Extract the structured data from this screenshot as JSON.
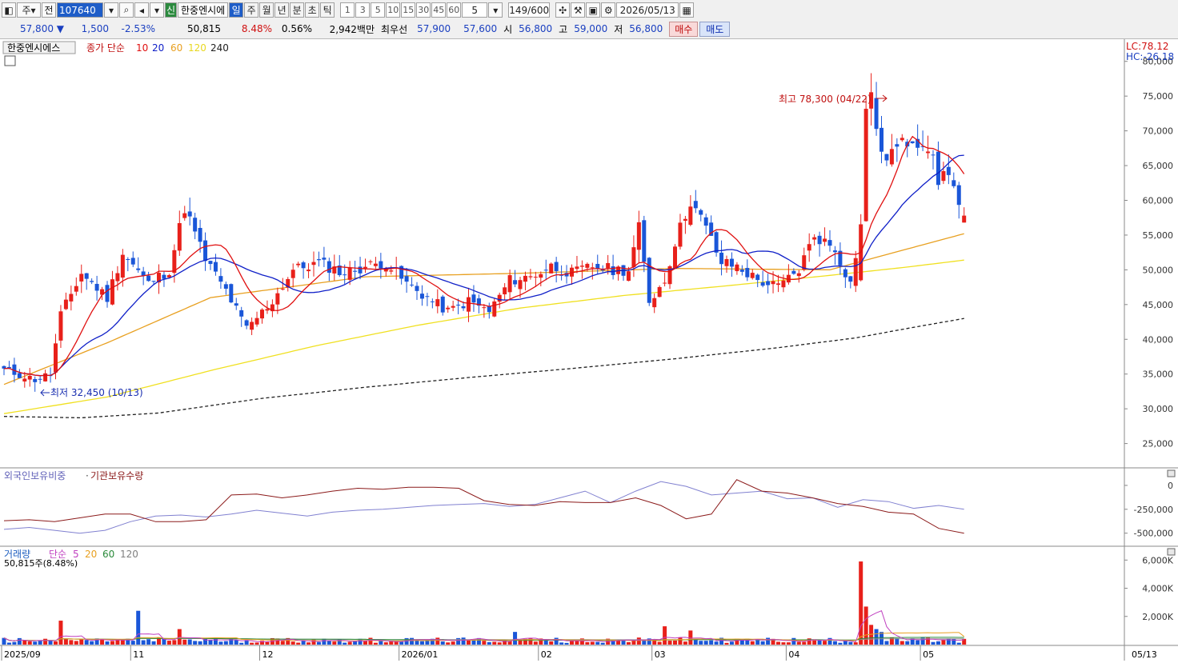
{
  "toolbar": {
    "mode_label": "주",
    "type_label": "전",
    "code": "107640",
    "name": "한중엔시에",
    "badge_new": "신",
    "periods": [
      "일",
      "주",
      "월",
      "년",
      "분",
      "초",
      "틱"
    ],
    "active_period": "일",
    "intervals": [
      "1",
      "3",
      "5",
      "10",
      "15",
      "30",
      "45",
      "60"
    ],
    "unit_value": "5",
    "count": "149/600",
    "date": "2026/05/13"
  },
  "quote": {
    "price": "57,800 ▼",
    "change": "1,500",
    "change_pct": "-2.53%",
    "volume": "50,815",
    "turnover_pct": "8.48%",
    "ratio": "0.56%",
    "amount": "2,942백만",
    "best_label": "최우선",
    "best_ask": "57,900",
    "best_bid": "57,600",
    "open_label": "시",
    "open": "56,800",
    "high_label": "고",
    "high": "59,000",
    "low_label": "저",
    "low": "56,800",
    "buy_label": "매수",
    "sell_label": "매도"
  },
  "colors": {
    "up": "#e8201a",
    "down": "#1a56d8",
    "ma10": "#e01010",
    "ma20": "#1020c8",
    "ma60": "#e8a020",
    "ma120": "#f0e020",
    "ma240": "#202020",
    "foreign": "#8080d0",
    "inst": "#8b1a1a"
  },
  "chart_data": [
    {
      "type": "candlestick",
      "legend": {
        "name": "한중엔시에스",
        "price_label": "종가 단순",
        "ma": [
          "10",
          "20",
          "60",
          "120",
          "240"
        ]
      },
      "corner_labels": [
        "LC:78.12",
        "HC:-26.18"
      ],
      "y_ticks": [
        "80,000",
        "75,000",
        "70,000",
        "65,000",
        "60,000",
        "55,000",
        "50,000",
        "45,000",
        "40,000",
        "35,000",
        "30,000",
        "25,000"
      ],
      "ylim": [
        21500,
        82500
      ],
      "annotations": {
        "high": "최고 78,300 (04/22)",
        "low": "최저 32,450 (10/13)"
      },
      "x_ticks": [
        "2025/09",
        "11",
        "12",
        "2026/01",
        "02",
        "03",
        "04",
        "05"
      ],
      "last_date_label": "05/13",
      "anchors": [
        {
          "i": 0,
          "c": 35600
        },
        {
          "i": 6,
          "c": 34200
        },
        {
          "i": 9,
          "c": 35000
        },
        {
          "i": 11,
          "c": 43500
        },
        {
          "i": 15,
          "c": 49500
        },
        {
          "i": 20,
          "c": 46000
        },
        {
          "i": 23,
          "c": 52500
        },
        {
          "i": 28,
          "c": 48000
        },
        {
          "i": 32,
          "c": 50000
        },
        {
          "i": 35,
          "c": 59000
        },
        {
          "i": 39,
          "c": 51500
        },
        {
          "i": 43,
          "c": 47000
        },
        {
          "i": 47,
          "c": 41500
        },
        {
          "i": 52,
          "c": 45500
        },
        {
          "i": 56,
          "c": 50000
        },
        {
          "i": 61,
          "c": 51000
        },
        {
          "i": 66,
          "c": 49500
        },
        {
          "i": 70,
          "c": 50500
        },
        {
          "i": 74,
          "c": 51000
        },
        {
          "i": 78,
          "c": 48000
        },
        {
          "i": 82,
          "c": 46000
        },
        {
          "i": 86,
          "c": 44000
        },
        {
          "i": 90,
          "c": 45500
        },
        {
          "i": 94,
          "c": 44000
        },
        {
          "i": 98,
          "c": 48500
        },
        {
          "i": 102,
          "c": 49000
        },
        {
          "i": 106,
          "c": 50500
        },
        {
          "i": 110,
          "c": 49500
        },
        {
          "i": 114,
          "c": 50500
        },
        {
          "i": 118,
          "c": 50000
        },
        {
          "i": 121,
          "c": 50000
        },
        {
          "i": 123,
          "c": 56000
        },
        {
          "i": 125,
          "c": 45500
        },
        {
          "i": 128,
          "c": 48500
        },
        {
          "i": 130,
          "c": 54000
        },
        {
          "i": 133,
          "c": 60000
        },
        {
          "i": 136,
          "c": 56000
        },
        {
          "i": 139,
          "c": 51000
        },
        {
          "i": 142,
          "c": 50500
        },
        {
          "i": 146,
          "c": 48500
        },
        {
          "i": 150,
          "c": 47500
        },
        {
          "i": 154,
          "c": 50000
        },
        {
          "i": 157,
          "c": 55000
        },
        {
          "i": 161,
          "c": 53000
        },
        {
          "i": 164,
          "c": 48000
        },
        {
          "i": 166,
          "c": 56500
        },
        {
          "i": 167,
          "c": 72500
        },
        {
          "i": 168,
          "c": 75800
        },
        {
          "i": 170,
          "c": 66000
        },
        {
          "i": 173,
          "c": 67500
        },
        {
          "i": 176,
          "c": 69000
        },
        {
          "i": 179,
          "c": 68000
        },
        {
          "i": 181,
          "c": 62800
        },
        {
          "i": 183,
          "c": 64500
        },
        {
          "i": 185,
          "c": 59200
        },
        {
          "i": 186,
          "c": 57800
        }
      ],
      "ma_anchors": {
        "ma60": [
          [
            0,
            33500
          ],
          [
            20,
            39500
          ],
          [
            40,
            46000
          ],
          [
            70,
            49000
          ],
          [
            100,
            49500
          ],
          [
            130,
            50200
          ],
          [
            160,
            50000
          ],
          [
            175,
            53000
          ],
          [
            186,
            55200
          ]
        ],
        "ma120": [
          [
            0,
            29300
          ],
          [
            20,
            31700
          ],
          [
            40,
            35500
          ],
          [
            60,
            39000
          ],
          [
            80,
            42000
          ],
          [
            100,
            44500
          ],
          [
            120,
            46300
          ],
          [
            140,
            47700
          ],
          [
            160,
            49200
          ],
          [
            175,
            50400
          ],
          [
            186,
            51400
          ]
        ],
        "ma240": [
          [
            0,
            28900
          ],
          [
            15,
            28700
          ],
          [
            30,
            29400
          ],
          [
            50,
            31500
          ],
          [
            70,
            33100
          ],
          [
            90,
            34500
          ],
          [
            110,
            35800
          ],
          [
            130,
            37200
          ],
          [
            150,
            38800
          ],
          [
            165,
            40200
          ],
          [
            176,
            41700
          ],
          [
            186,
            43000
          ]
        ]
      }
    },
    {
      "type": "line",
      "title_a": "외국인보유비중",
      "title_b": "기관보유수량",
      "y_ticks": [
        "0",
        "-250,000",
        "-500,000"
      ],
      "ylim": [
        -620000,
        150000
      ],
      "series": [
        {
          "name": "외국인보유비중",
          "values": [
            -460000,
            -440000,
            -470000,
            -500000,
            -470000,
            -380000,
            -320000,
            -310000,
            -330000,
            -300000,
            -260000,
            -290000,
            -320000,
            -280000,
            -260000,
            -250000,
            -230000,
            -210000,
            -200000,
            -190000,
            -220000,
            -200000,
            -130000,
            -60000,
            -180000,
            -60000,
            40000,
            -10000,
            -100000,
            -80000,
            -60000,
            -140000,
            -130000,
            -230000,
            -150000,
            -170000,
            -240000,
            -210000,
            -250000
          ]
        },
        {
          "name": "기관보유수량",
          "values": [
            -370000,
            -360000,
            -380000,
            -340000,
            -300000,
            -300000,
            -380000,
            -380000,
            -360000,
            -100000,
            -90000,
            -130000,
            -100000,
            -60000,
            -30000,
            -40000,
            -20000,
            -20000,
            -30000,
            -160000,
            -200000,
            -210000,
            -170000,
            -180000,
            -180000,
            -130000,
            -210000,
            -350000,
            -300000,
            60000,
            -60000,
            -80000,
            -130000,
            -190000,
            -220000,
            -280000,
            -300000,
            -450000,
            -500000
          ]
        }
      ]
    },
    {
      "type": "bar",
      "title": "거래량",
      "ma_label": "단순",
      "ma": [
        "5",
        "20",
        "60",
        "120"
      ],
      "sub_label": "50,815주(8.48%)",
      "y_ticks": [
        "6,000K",
        "4,000K",
        "2,000K"
      ],
      "ylim": [
        0,
        6300000
      ],
      "spikes": [
        {
          "i": 11,
          "v": 1700000
        },
        {
          "i": 26,
          "v": 2400000
        },
        {
          "i": 34,
          "v": 1100000
        },
        {
          "i": 99,
          "v": 900000
        },
        {
          "i": 128,
          "v": 1300000
        },
        {
          "i": 133,
          "v": 1000000
        },
        {
          "i": 166,
          "v": 5900000
        },
        {
          "i": 167,
          "v": 2700000
        },
        {
          "i": 168,
          "v": 1400000
        },
        {
          "i": 169,
          "v": 1100000
        },
        {
          "i": 170,
          "v": 900000
        }
      ]
    }
  ]
}
